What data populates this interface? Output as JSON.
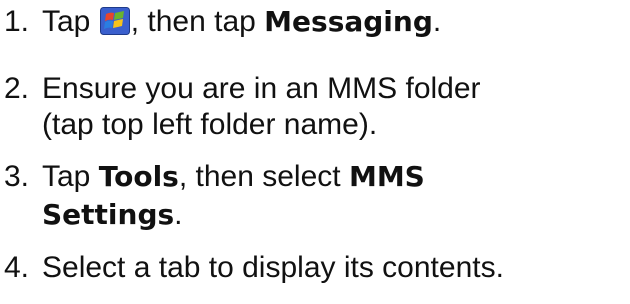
{
  "steps": [
    {
      "number": "1.",
      "text_before": "Tap",
      "icon": "windows-start-icon",
      "text_middle": ", then tap",
      "ui_term": "Messaging",
      "text_after": "."
    },
    {
      "number": "2.",
      "line1": "Ensure you are in an MMS folder",
      "line2": "(tap top left folder name)."
    },
    {
      "number": "3.",
      "text_before": "Tap",
      "ui_term1": "Tools",
      "text_middle": ", then select",
      "ui_term2a": "MMS",
      "ui_term2b": "Settings",
      "text_after": "."
    },
    {
      "number": "4.",
      "text": "Select a tab to display its contents."
    }
  ],
  "colors": {
    "text": "#111111",
    "icon_red": "#e8452c",
    "icon_green": "#6ab42d",
    "icon_blue": "#2a7de1",
    "icon_yellow": "#f7c31c",
    "icon_frame": "#3a5fcd"
  }
}
